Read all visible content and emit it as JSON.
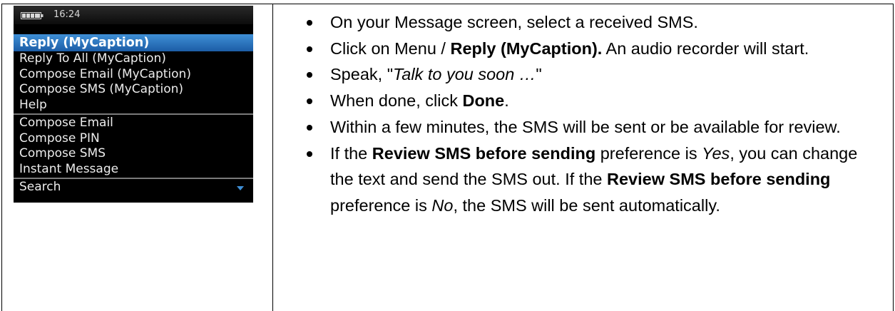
{
  "phone": {
    "status_time": "16:24",
    "battery_icon": "battery-icon",
    "highlight_color": "#2f78c4",
    "menu_items": [
      "Reply (MyCaption)",
      "Reply To All (MyCaption)",
      "Compose Email (MyCaption)",
      "Compose SMS (MyCaption)",
      "Help",
      "Compose Email",
      "Compose PIN",
      "Compose SMS",
      "Instant Message",
      "Search"
    ],
    "scroll_icon": "chevron-down-icon"
  },
  "steps": {
    "s1": {
      "text": "On your Message screen, select a received SMS."
    },
    "s2": {
      "a": "Click on Menu / ",
      "b": "Reply (MyCaption).",
      "c": " An audio recorder will start."
    },
    "s3": {
      "a": "Speak, \"",
      "b": "Talk to you soon …",
      "c": "\""
    },
    "s4": {
      "a": "When done, click ",
      "b": "Done",
      "c": "."
    },
    "s5": {
      "text": "Within a few minutes, the SMS will be sent or be available for review."
    },
    "s6": {
      "a": "If the ",
      "b": "Review SMS before sending",
      "c": " preference is ",
      "d": "Yes",
      "e": ", you can change the text and send the SMS out. If the ",
      "f": "Review SMS before sending",
      "g": " preference is ",
      "h": "No",
      "i": ", the SMS will be sent automatically."
    }
  }
}
